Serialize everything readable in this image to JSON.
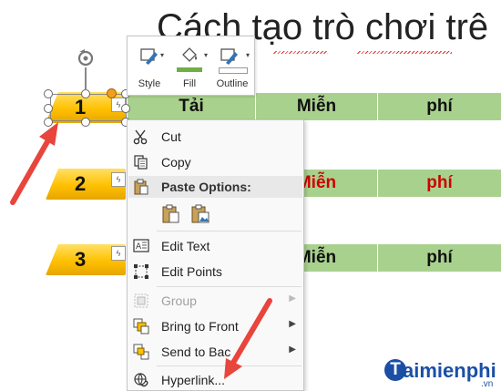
{
  "slide": {
    "title": "Cách tạo trò chơi trê"
  },
  "table": {
    "rows": [
      {
        "cells": [
          "Tải",
          "Miễn",
          "phí"
        ],
        "style": "header"
      },
      {
        "cells": [
          "",
          "Miễn",
          "phí"
        ],
        "style": "red"
      },
      {
        "cells": [
          "",
          "Miễn",
          "phí"
        ],
        "style": "black"
      }
    ]
  },
  "shapes": [
    {
      "number": "1",
      "selected": true
    },
    {
      "number": "2",
      "selected": false
    },
    {
      "number": "3",
      "selected": false
    }
  ],
  "mini_toolbar": {
    "style_label": "Style",
    "fill_label": "Fill",
    "outline_label": "Outline",
    "fill_color": "#70ad47"
  },
  "context_menu": {
    "cut": "Cut",
    "copy": "Copy",
    "paste_options": "Paste Options:",
    "edit_text": "Edit Text",
    "edit_points": "Edit Points",
    "group": "Group",
    "bring_to_front": "Bring to Front",
    "send_to_back": "Send to Bac",
    "hyperlink": "Hyperlink..."
  },
  "watermark": {
    "brand_initial": "T",
    "brand_rest": "aimienphi",
    "tld": ".vn"
  },
  "colors": {
    "table_green": "#a9d18e",
    "shape_yellow": "#ffc000",
    "accent_red": "#e8453c",
    "brand_blue": "#1b4fa6"
  }
}
